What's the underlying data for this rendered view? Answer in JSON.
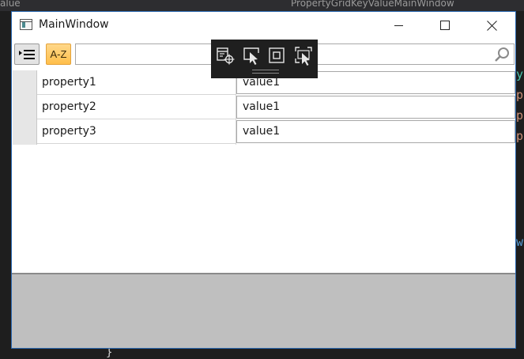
{
  "background": {
    "top_left_text": "alue",
    "top_tab_text": "PropertyGridKeyValueMainWindow"
  },
  "window": {
    "title": "MainWindow",
    "controls": {
      "minimize": "minimize",
      "maximize": "maximize",
      "close": "close"
    }
  },
  "toolbar": {
    "categorized_icon": "categorized-list-icon",
    "az_label": "A-Z",
    "search_value": "",
    "search_icon": "search-icon"
  },
  "properties": [
    {
      "name": "property1",
      "value": "value1"
    },
    {
      "name": "property2",
      "value": "value1"
    },
    {
      "name": "property3",
      "value": "value1"
    }
  ],
  "runtime_toolbar": {
    "tools": [
      "live-visual-tree-icon",
      "select-element-icon",
      "display-adorners-icon",
      "track-focus-icon"
    ]
  },
  "colors": {
    "window_border": "#2c6ab3",
    "az_button": "#ffbf4a",
    "bottom_panel": "#bfbfbf",
    "ide_background": "#1e1e1e"
  }
}
